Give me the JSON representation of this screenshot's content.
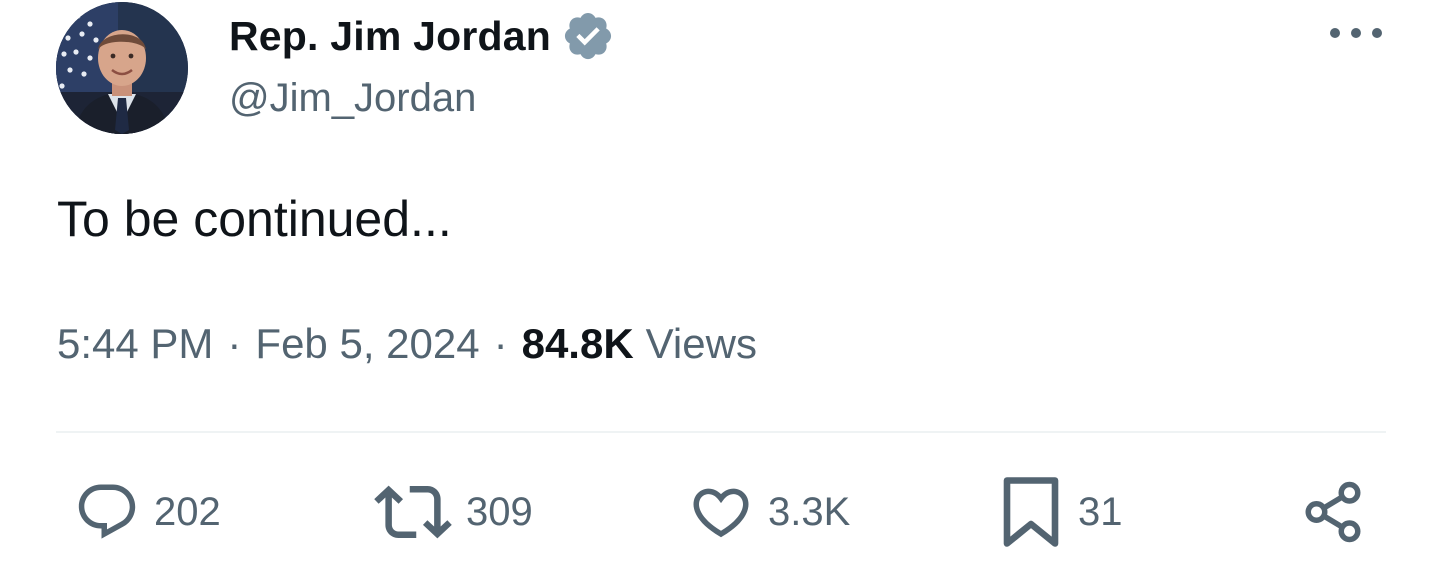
{
  "author": {
    "display_name": "Rep. Jim Jordan",
    "handle": "@Jim_Jordan",
    "verified_color": "#829aab"
  },
  "tweet": {
    "text": "To be continued..."
  },
  "meta": {
    "time": "5:44 PM",
    "separator": "·",
    "date": "Feb 5, 2024",
    "views_count": "84.8K",
    "views_label": "Views"
  },
  "actions": {
    "replies": "202",
    "reposts": "309",
    "likes": "3.3K",
    "bookmarks": "31"
  },
  "icons": {
    "reply": "speech-bubble-icon",
    "repost": "repost-arrows-icon",
    "like": "heart-icon",
    "bookmark": "bookmark-icon",
    "share": "share-nodes-icon",
    "more": "more-horizontal-icon"
  },
  "colors": {
    "text_primary": "#0f1419",
    "text_secondary": "#536471",
    "divider": "#eff3f4"
  }
}
